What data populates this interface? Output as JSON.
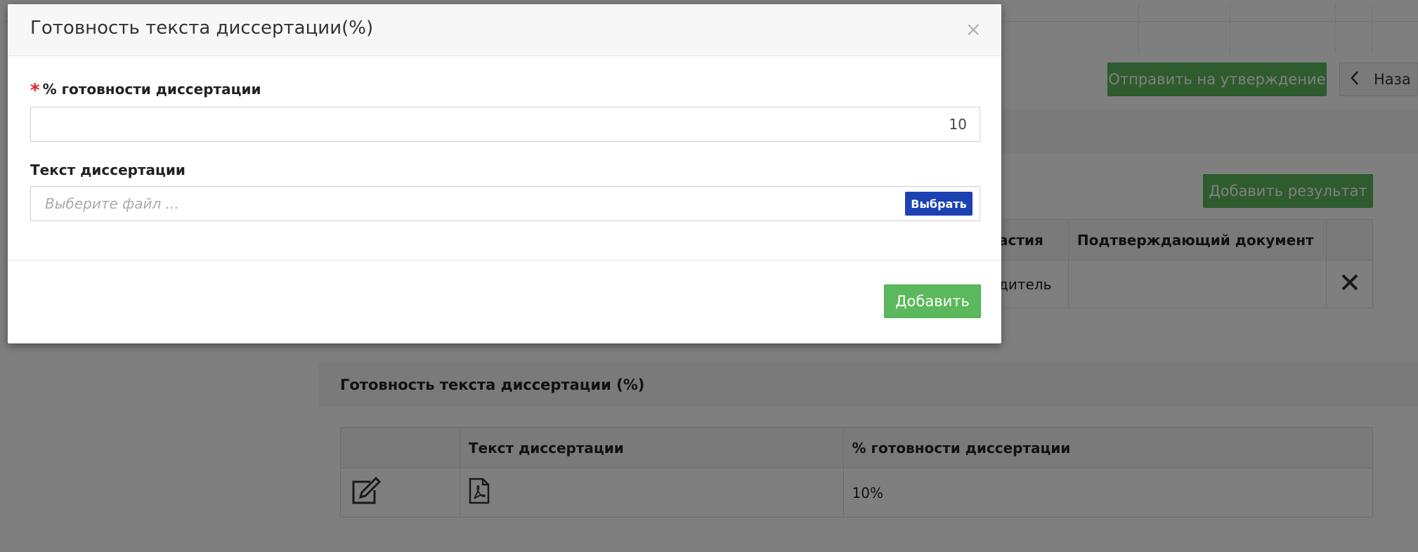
{
  "background": {
    "send_for_approval_label": "Отправить на утверждение",
    "back_label": "Наза",
    "add_result_label": "Добавить результат",
    "results_table": {
      "col_participation": "астия",
      "col_supporting_document": "Подтверждающий документ",
      "row_role": "дитель"
    },
    "readiness_section_title": "Готовность текста диссертации (%)",
    "readiness_table": {
      "col_text": "Текст диссертации",
      "col_percent": "% готовности диссертации",
      "row_percent": "10%"
    }
  },
  "modal": {
    "title": "Готовность текста диссертации(%)",
    "close_glyph": "×",
    "required_mark": "*",
    "percent_label": "% готовности диссертации",
    "percent_value": "10",
    "text_label": "Текст диссертации",
    "file_placeholder": "Выберите файл ...",
    "choose_label": "Выбрать",
    "add_label": "Добавить"
  },
  "colors": {
    "green": "#5cb85c",
    "blue": "#1c41b3",
    "required": "#e02424"
  },
  "icons": [
    "close-icon",
    "delete-x-icon",
    "edit-icon",
    "pdf-icon",
    "chevron-left-icon"
  ]
}
